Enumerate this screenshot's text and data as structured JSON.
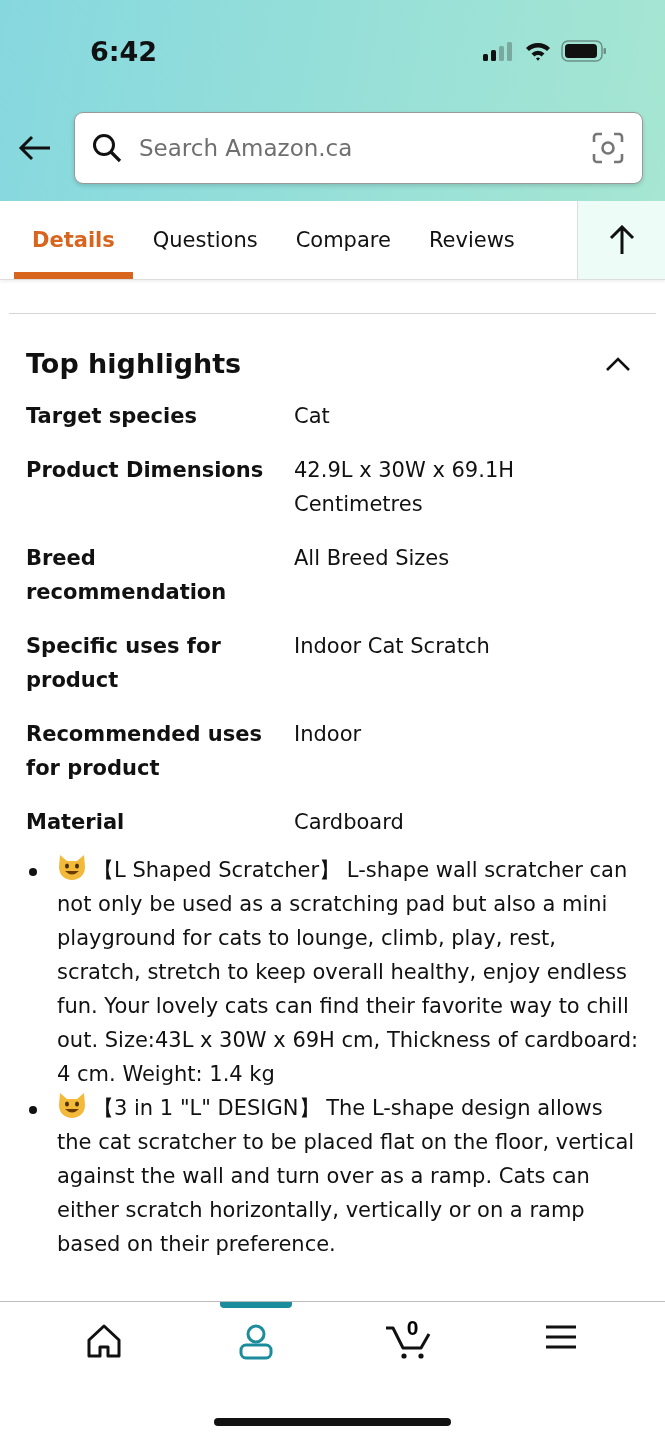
{
  "status_bar": {
    "time": "6:42"
  },
  "search": {
    "placeholder": "Search Amazon.ca"
  },
  "tabs": [
    {
      "label": "Details",
      "selected": true
    },
    {
      "label": "Questions",
      "selected": false
    },
    {
      "label": "Compare",
      "selected": false
    },
    {
      "label": "Reviews",
      "selected": false
    }
  ],
  "section": {
    "title": "Top highlights",
    "expanded": true
  },
  "specs": [
    {
      "label": "Target species",
      "value": "Cat"
    },
    {
      "label": "Product Dimensions",
      "value": "42.9L x 30W x 69.1H Centimetres"
    },
    {
      "label": "Breed recommendation",
      "value": "All Breed Sizes"
    },
    {
      "label": "Specific uses for product",
      "value": "Indoor Cat Scratch"
    },
    {
      "label": "Recommended uses for product",
      "value": "Indoor"
    },
    {
      "label": "Material",
      "value": "Cardboard"
    }
  ],
  "bullets": [
    "【L Shaped Scratcher】 L-shape wall scratcher can not only be used as a scratching pad but also a mini playground for cats to lounge, climb, play, rest, scratch, stretch to keep overall healthy, enjoy endless fun. Your lovely cats can find their favorite way to chill out. Size:43L x 30W x 69H cm, Thickness of cardboard: 4 cm. Weight: 1.4 kg",
    "【3 in 1 \"L\" DESIGN】 The L-shape design allows the cat scratcher to be placed flat on the floor, vertical against the wall and turn over as a ramp. Cats can either scratch horizontally, vertically or on a ramp based on their preference."
  ],
  "bottom_nav": [
    {
      "kind": "home",
      "selected": false
    },
    {
      "kind": "account",
      "selected": true
    },
    {
      "kind": "cart",
      "selected": false,
      "count": "0"
    },
    {
      "kind": "menu",
      "selected": false
    }
  ]
}
